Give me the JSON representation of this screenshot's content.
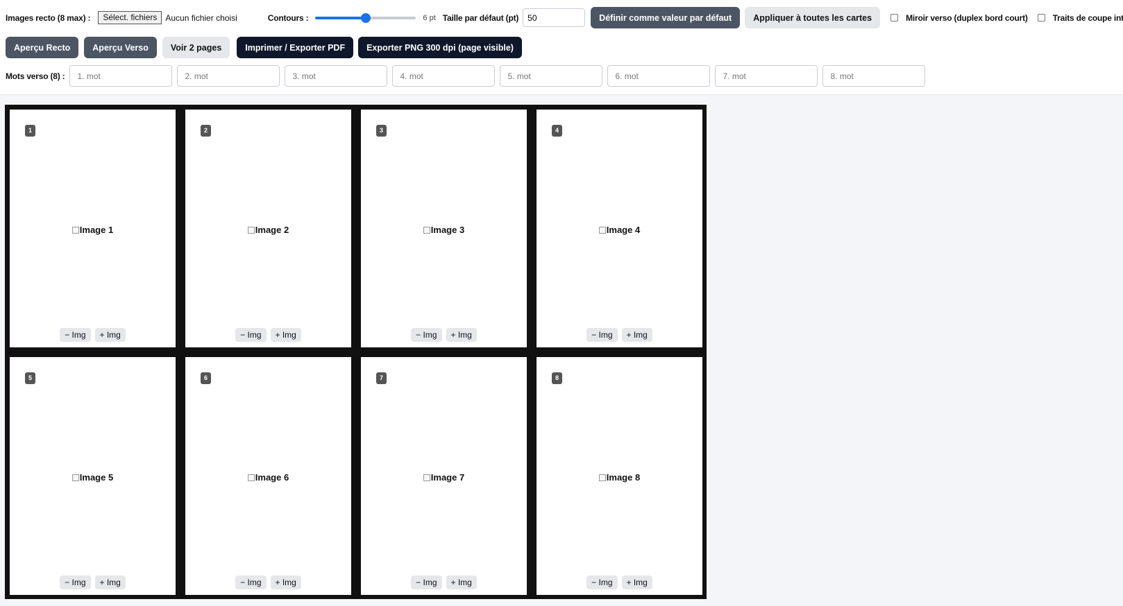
{
  "toolbar": {
    "images_label": "Images recto (8 max) :",
    "file_button": "Sélect. fichiers",
    "file_status": "Aucun fichier choisi",
    "contours_label": "Contours :",
    "contours_value": 6,
    "contours_max": 12,
    "contours_display": "6 pt",
    "default_size_label": "Taille par défaut (pt)",
    "default_size_value": "50",
    "set_default_button": "Définir comme valeur par défaut",
    "apply_all_button": "Appliquer à toutes les cartes",
    "mirror_checkbox": {
      "label": "Miroir verso (duplex bord court)",
      "checked": false
    },
    "cut_lines_checkbox": {
      "label": "Traits de coupe internes",
      "checked": false
    }
  },
  "actions": {
    "preview_recto": "Aperçu Recto",
    "preview_verso": "Aperçu Verso",
    "view_two_pages": "Voir 2 pages",
    "print_pdf": "Imprimer / Exporter PDF",
    "export_png": "Exporter PNG 300 dpi (page visible)"
  },
  "words": {
    "label": "Mots verso (8) :",
    "placeholders": [
      "1. mot",
      "2. mot",
      "3. mot",
      "4. mot",
      "5. mot",
      "6. mot",
      "7. mot",
      "8. mot"
    ]
  },
  "cards": [
    {
      "number": "1",
      "image_alt": "Image 1",
      "minus": "− Img",
      "plus": "+ Img"
    },
    {
      "number": "2",
      "image_alt": "Image 2",
      "minus": "− Img",
      "plus": "+ Img"
    },
    {
      "number": "3",
      "image_alt": "Image 3",
      "minus": "− Img",
      "plus": "+ Img"
    },
    {
      "number": "4",
      "image_alt": "Image 4",
      "minus": "− Img",
      "plus": "+ Img"
    },
    {
      "number": "5",
      "image_alt": "Image 5",
      "minus": "− Img",
      "plus": "+ Img"
    },
    {
      "number": "6",
      "image_alt": "Image 6",
      "minus": "− Img",
      "plus": "+ Img"
    },
    {
      "number": "7",
      "image_alt": "Image 7",
      "minus": "− Img",
      "plus": "+ Img"
    },
    {
      "number": "8",
      "image_alt": "Image 8",
      "minus": "− Img",
      "plus": "+ Img"
    }
  ],
  "colors": {
    "accent": "#1a73e8",
    "slate_button": "#4b5563",
    "dark_button": "#0f172a",
    "sheet_background": "#111111"
  }
}
